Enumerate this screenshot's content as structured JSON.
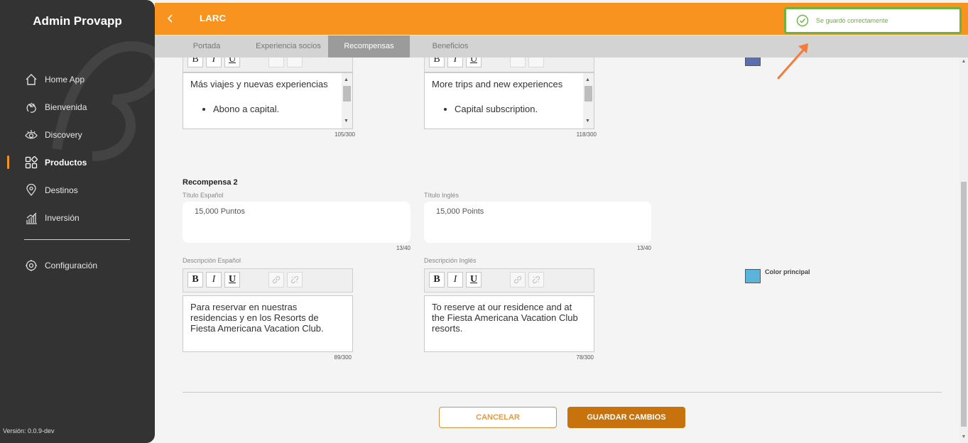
{
  "sidebar": {
    "brand": "Admin Provapp",
    "items": [
      {
        "label": "Home App",
        "icon": "home-icon"
      },
      {
        "label": "Bienvenida",
        "icon": "waving-hand-icon"
      },
      {
        "label": "Discovery",
        "icon": "eye-icon"
      },
      {
        "label": "Productos",
        "icon": "grid-icon",
        "active": true
      },
      {
        "label": "Destinos",
        "icon": "map-pin-icon"
      },
      {
        "label": "Inversión",
        "icon": "bar-chart-icon"
      }
    ],
    "config_label": "Configuración",
    "version": "Versión: 0.0.9-dev"
  },
  "header": {
    "title": "LARC",
    "accent": "#f7931e"
  },
  "tabs": [
    {
      "label": "Portada"
    },
    {
      "label": "Experiencia socios"
    },
    {
      "label": "Recompensas",
      "active": true
    },
    {
      "label": "Beneficios"
    }
  ],
  "reward1": {
    "desc_es_line1": "Más viajes y nuevas experiencias",
    "desc_es_bullet": "Abono a capital.",
    "desc_es_counter": "105/300",
    "desc_en_line1": "More trips and new experiences",
    "desc_en_bullet": "Capital subscription.",
    "desc_en_counter": "118/300"
  },
  "reward2": {
    "section_title": "Recompensa 2",
    "title_es_label": "Título Español",
    "title_es_value": "15,000 Puntos",
    "title_es_counter": "13/40",
    "title_en_label": "Título Inglés",
    "title_en_value": "15,000 Points",
    "title_en_counter": "13/40",
    "desc_es_label": "Descripción Español",
    "desc_es_value": "Para reservar en nuestras residencias y en los Resorts de Fiesta Americana Vacation Club.",
    "desc_es_counter": "89/300",
    "desc_en_label": "Descripción Inglés",
    "desc_en_value": "To reserve at our residence and at the Fiesta Americana Vacation Club resorts.",
    "desc_en_counter": "78/300",
    "color_label": "Color principal",
    "color_value": "#5ab4dc"
  },
  "toolbar": {
    "bold": "B",
    "italic": "I",
    "underline": "U"
  },
  "actions": {
    "cancel": "CANCELAR",
    "save": "GUARDAR CAMBIOS"
  },
  "toast": {
    "message": "Se guardó correctamente",
    "color": "#6cb33f"
  }
}
